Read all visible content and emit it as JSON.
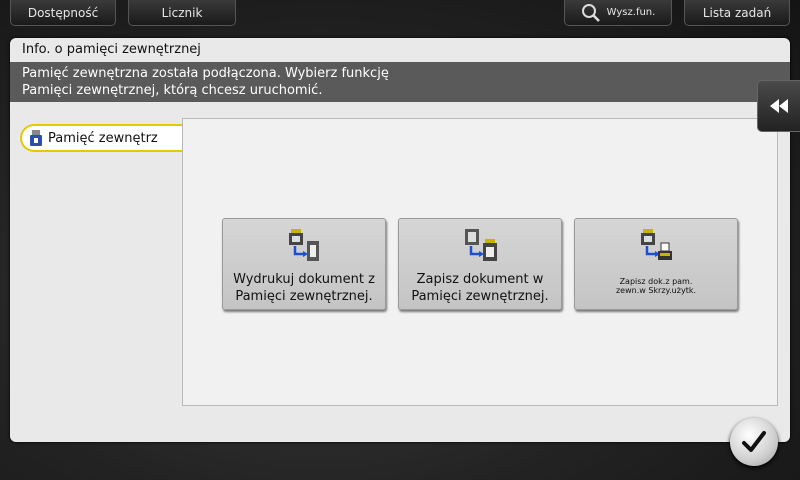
{
  "topbar": {
    "availability_label": "Dostępność",
    "counter_label": "Licznik",
    "search_label": "Wysz.fun.",
    "joblist_label": "Lista zadań"
  },
  "panel": {
    "title": "Info. o pamięci zewnętrznej",
    "message_line1": "Pamięć zewnętrzna została podłączona. Wybierz funkcję",
    "message_line2": "Pamięci zewnętrznej, którą chcesz uruchomić."
  },
  "left_tab": {
    "label": "Pamięć zewnętrz"
  },
  "functions": [
    {
      "line1": "Wydrukuj dokument z",
      "line2": "Pamięci zewnętrznej."
    },
    {
      "line1": "Zapisz dokument w",
      "line2": "Pamięci zewnętrznej."
    },
    {
      "line1": "Zapisz dok.z pam.",
      "line2": "zewn.w Skrzy.użytk."
    }
  ],
  "colors": {
    "accent": "#e8c800",
    "message_bg": "#5a5a5a"
  },
  "icons": [
    "search-icon",
    "usb-memory-icon",
    "collapse-arrow-icon",
    "checkmark-icon"
  ]
}
